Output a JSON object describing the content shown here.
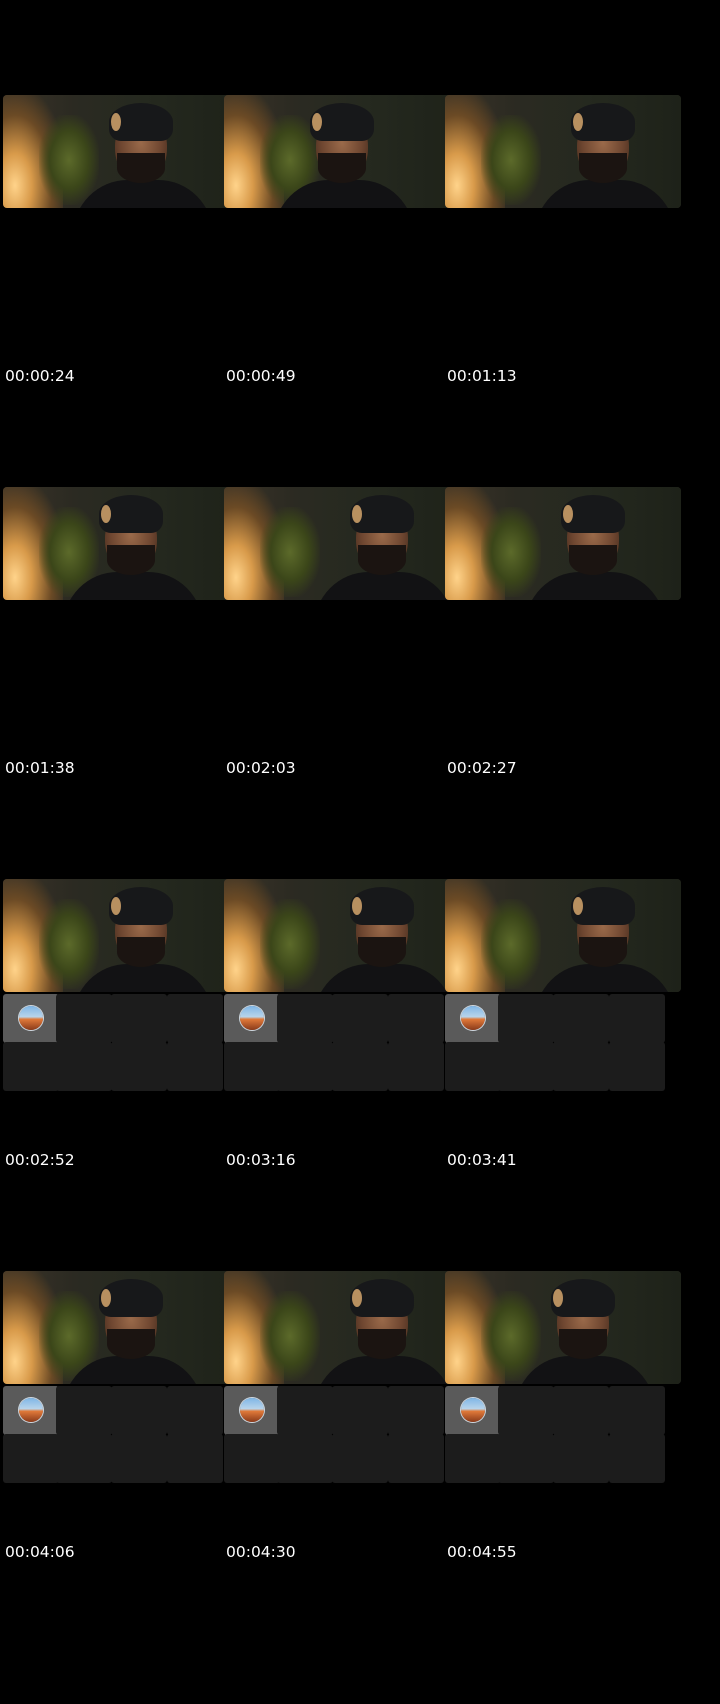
{
  "thumbnails": [
    {
      "time": "00:00:24",
      "has_tiles": false
    },
    {
      "time": "00:00:49",
      "has_tiles": false
    },
    {
      "time": "00:01:13",
      "has_tiles": false
    },
    {
      "time": "00:01:38",
      "has_tiles": false
    },
    {
      "time": "00:02:03",
      "has_tiles": false
    },
    {
      "time": "00:02:27",
      "has_tiles": false
    },
    {
      "time": "00:02:52",
      "has_tiles": true
    },
    {
      "time": "00:03:16",
      "has_tiles": true
    },
    {
      "time": "00:03:41",
      "has_tiles": true
    },
    {
      "time": "00:04:06",
      "has_tiles": true
    },
    {
      "time": "00:04:30",
      "has_tiles": true
    },
    {
      "time": "00:04:55",
      "has_tiles": true
    }
  ],
  "icons": {
    "avatar_tile": "globe-avatar-icon"
  }
}
